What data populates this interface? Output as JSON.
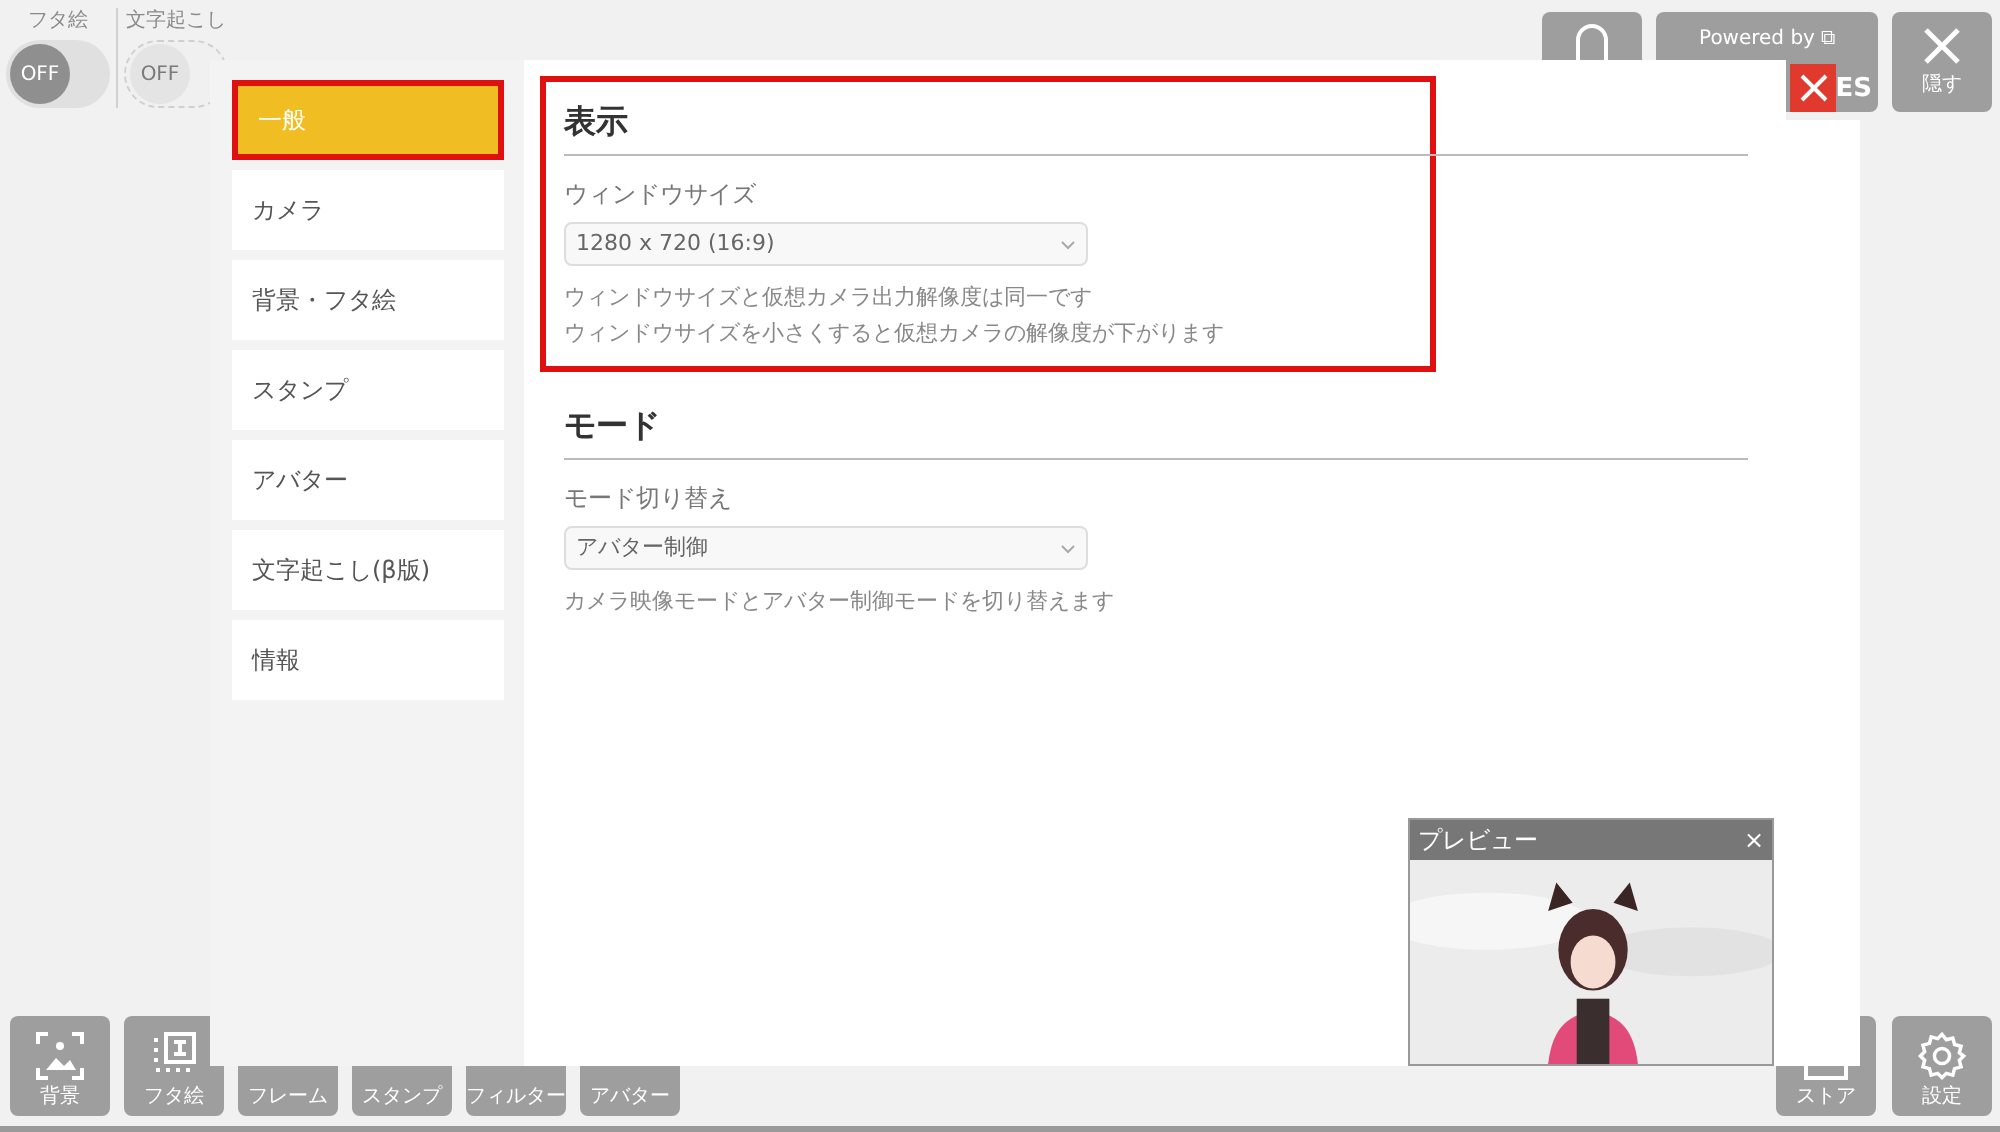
{
  "top_toggles": [
    {
      "label": "フタ絵",
      "value": "OFF",
      "on": false,
      "disabled": false
    },
    {
      "label": "文字起こし",
      "value": "OFF",
      "on": false,
      "disabled": true
    }
  ],
  "top_buttons": [
    {
      "kind": "bell"
    },
    {
      "kind": "powered",
      "label": "Powered by",
      "link_icon": "⧉",
      "tail": "ES"
    },
    {
      "kind": "hide",
      "label": "隠す"
    }
  ],
  "bottom_left": [
    {
      "label": "背景"
    },
    {
      "label": "フタ絵"
    },
    {
      "label": "フレーム"
    },
    {
      "label": "スタンプ"
    },
    {
      "label": "フィルター"
    },
    {
      "label": "アバター"
    }
  ],
  "bottom_right": [
    {
      "kind": "store",
      "label": "ストア"
    },
    {
      "kind": "gear",
      "label": "設定"
    }
  ],
  "sidebar": {
    "items": [
      {
        "label": "一般",
        "selected": true,
        "highlighted": true
      },
      {
        "label": "カメラ",
        "selected": false,
        "highlighted": false
      },
      {
        "label": "背景・フタ絵",
        "selected": false,
        "highlighted": false
      },
      {
        "label": "スタンプ",
        "selected": false,
        "highlighted": false
      },
      {
        "label": "アバター",
        "selected": false,
        "highlighted": false
      },
      {
        "label": "文字起こし(β版)",
        "selected": false,
        "highlighted": false
      },
      {
        "label": "情報",
        "selected": false,
        "highlighted": false
      }
    ]
  },
  "sections": [
    {
      "title": "表示",
      "highlighted": true,
      "field_label": "ウィンドウサイズ",
      "value": "1280 x 720 (16:9)",
      "notes": [
        "ウィンドウサイズと仮想カメラ出力解像度は同一です",
        "ウィンドウサイズを小さくすると仮想カメラの解像度が下がります"
      ]
    },
    {
      "title": "モード",
      "highlighted": false,
      "field_label": "モード切り替え",
      "value": "アバター制御",
      "notes": [
        "カメラ映像モードとアバター制御モードを切り替えます"
      ]
    }
  ],
  "preview": {
    "title": "プレビュー",
    "close": "×"
  }
}
